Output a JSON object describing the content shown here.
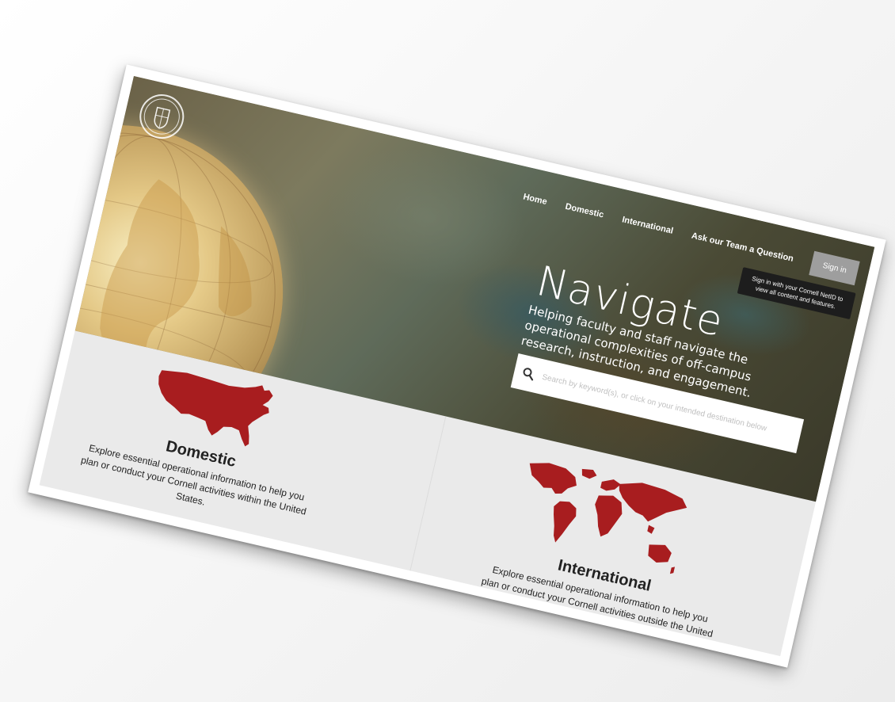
{
  "nav": {
    "items": [
      "Home",
      "Domestic",
      "International",
      "Ask our Team a Question"
    ],
    "sign_in": "Sign in",
    "tooltip": "Sign in with your Cornell NetID to view all content and features."
  },
  "hero": {
    "title": "Navigate",
    "tagline": "Helping faculty and staff navigate the operational complexities of off-campus research, instruction, and engagement."
  },
  "search": {
    "placeholder": "Search by keyword(s), or click on your intended destination below"
  },
  "panels": [
    {
      "title": "Domestic",
      "text": "Explore essential operational information to help you plan or conduct your Cornell activities within the United States."
    },
    {
      "title": "International",
      "text": "Explore essential operational information to help you plan or conduct your Cornell activities outside the United States."
    }
  ],
  "logo": {
    "text": "CORNELL UNIVERSITY FOUNDED A.D. 1865"
  },
  "colors": {
    "map_red": "#a81d1f",
    "panel_bg": "#eaeaea",
    "tooltip_bg": "#1d1d1d",
    "sign_in_bg": "#9e9e9e"
  }
}
